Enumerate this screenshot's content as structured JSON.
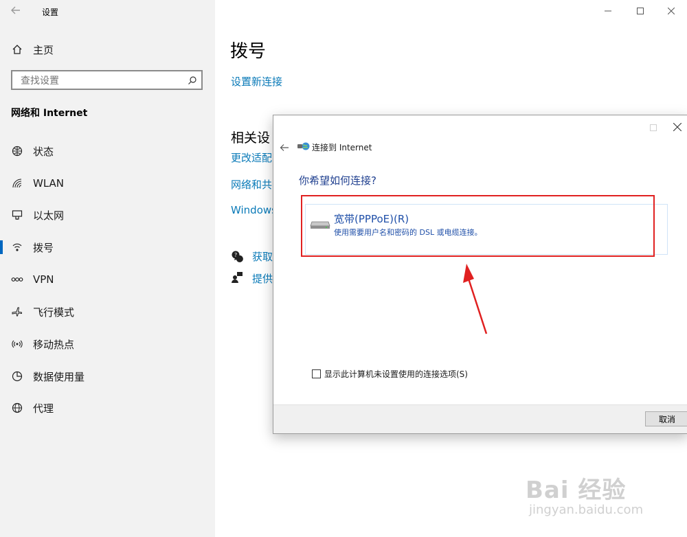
{
  "settings_window": {
    "title": "设置",
    "home_label": "主页",
    "search": {
      "placeholder": "查找设置"
    },
    "section_title": "网络和 Internet",
    "nav_items": [
      {
        "label": "状态",
        "icon": "globe-status-icon"
      },
      {
        "label": "WLAN",
        "icon": "wifi-icon"
      },
      {
        "label": "以太网",
        "icon": "ethernet-icon"
      },
      {
        "label": "拨号",
        "icon": "dialup-icon"
      },
      {
        "label": "VPN",
        "icon": "vpn-icon"
      },
      {
        "label": "飞行模式",
        "icon": "airplane-icon"
      },
      {
        "label": "移动热点",
        "icon": "hotspot-icon"
      },
      {
        "label": "数据使用量",
        "icon": "data-usage-icon"
      },
      {
        "label": "代理",
        "icon": "globe-icon"
      }
    ],
    "page_title": "拨号",
    "setup_link": "设置新连接",
    "related_heading": "相关设",
    "related_links": [
      "更改适配",
      "网络和共",
      "Windows"
    ],
    "help_links": [
      "获取",
      "提供"
    ]
  },
  "dialog": {
    "title": "连接到 Internet",
    "question": "你希望如何连接?",
    "option": {
      "title": "宽带(PPPoE)(R)",
      "description": "使用需要用户名和密码的 DSL 或电缆连接。"
    },
    "checkbox_label": "显示此计算机未设置使用的连接选项(S)",
    "cancel_label": "取消"
  },
  "watermark": {
    "text": "Bai 经验",
    "url": "jingyan.baidu.com"
  },
  "colors": {
    "accent": "#0a7ab8",
    "highlight": "#e02020",
    "sidebar": "#f2f2f2"
  }
}
